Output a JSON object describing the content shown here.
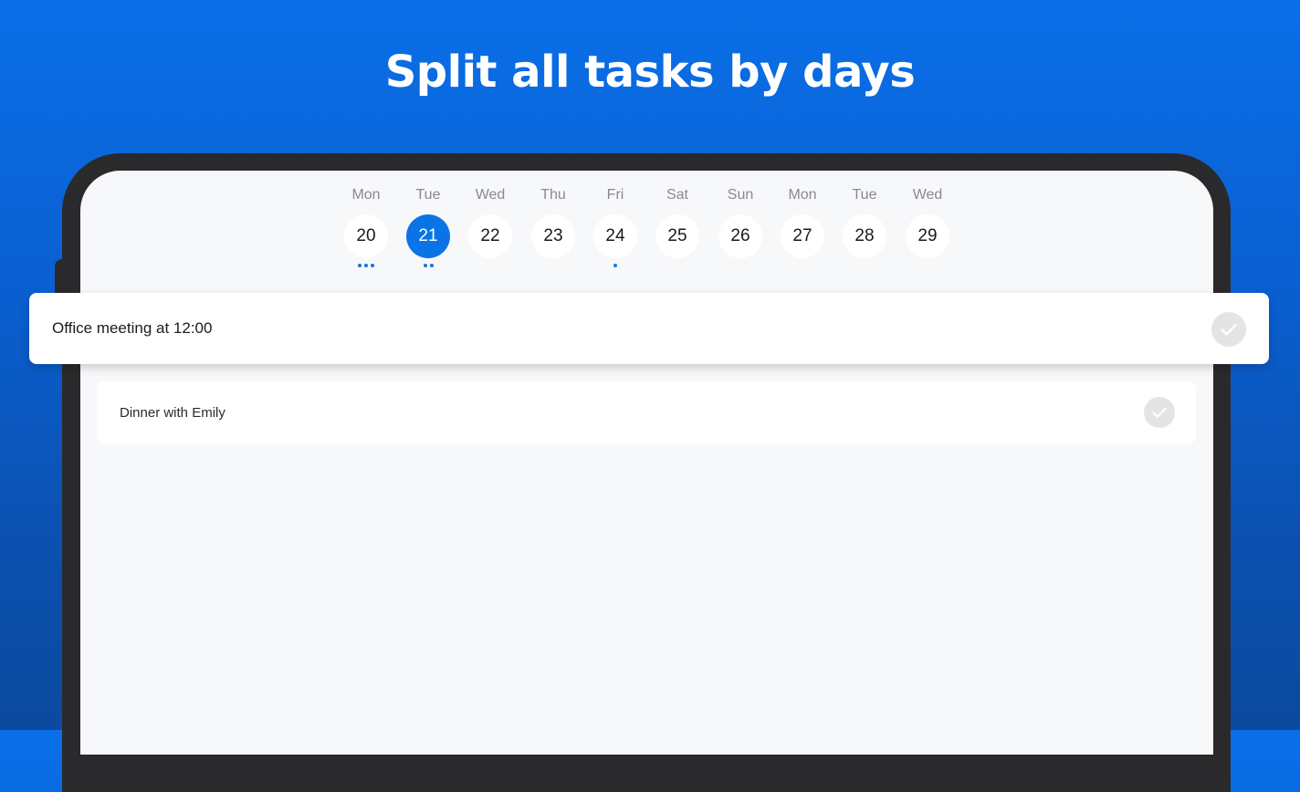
{
  "headline": "Split all tasks by days",
  "calendar": {
    "days": [
      {
        "weekday": "Mon",
        "date": "20",
        "selected": false,
        "dots": 3
      },
      {
        "weekday": "Tue",
        "date": "21",
        "selected": true,
        "dots": 2
      },
      {
        "weekday": "Wed",
        "date": "22",
        "selected": false,
        "dots": 0
      },
      {
        "weekday": "Thu",
        "date": "23",
        "selected": false,
        "dots": 0
      },
      {
        "weekday": "Fri",
        "date": "24",
        "selected": false,
        "dots": 1
      },
      {
        "weekday": "Sat",
        "date": "25",
        "selected": false,
        "dots": 0
      },
      {
        "weekday": "Sun",
        "date": "26",
        "selected": false,
        "dots": 0
      },
      {
        "weekday": "Mon",
        "date": "27",
        "selected": false,
        "dots": 0
      },
      {
        "weekday": "Tue",
        "date": "28",
        "selected": false,
        "dots": 0
      },
      {
        "weekday": "Wed",
        "date": "29",
        "selected": false,
        "dots": 0
      }
    ]
  },
  "tasks": [
    {
      "title": "Office meeting at 12:00",
      "completed": false,
      "highlighted": true
    },
    {
      "title": "Dinner with Emily",
      "completed": false,
      "highlighted": false
    }
  ],
  "colors": {
    "accent": "#0a74e6",
    "background_top": "#0a6fe8",
    "background_bottom": "#0b4a9e",
    "device_frame": "#2a2a2c",
    "screen": "#f7f8fa",
    "check_circle": "#e4e4e6"
  },
  "icons": {
    "task_check": "checkmark-icon"
  }
}
